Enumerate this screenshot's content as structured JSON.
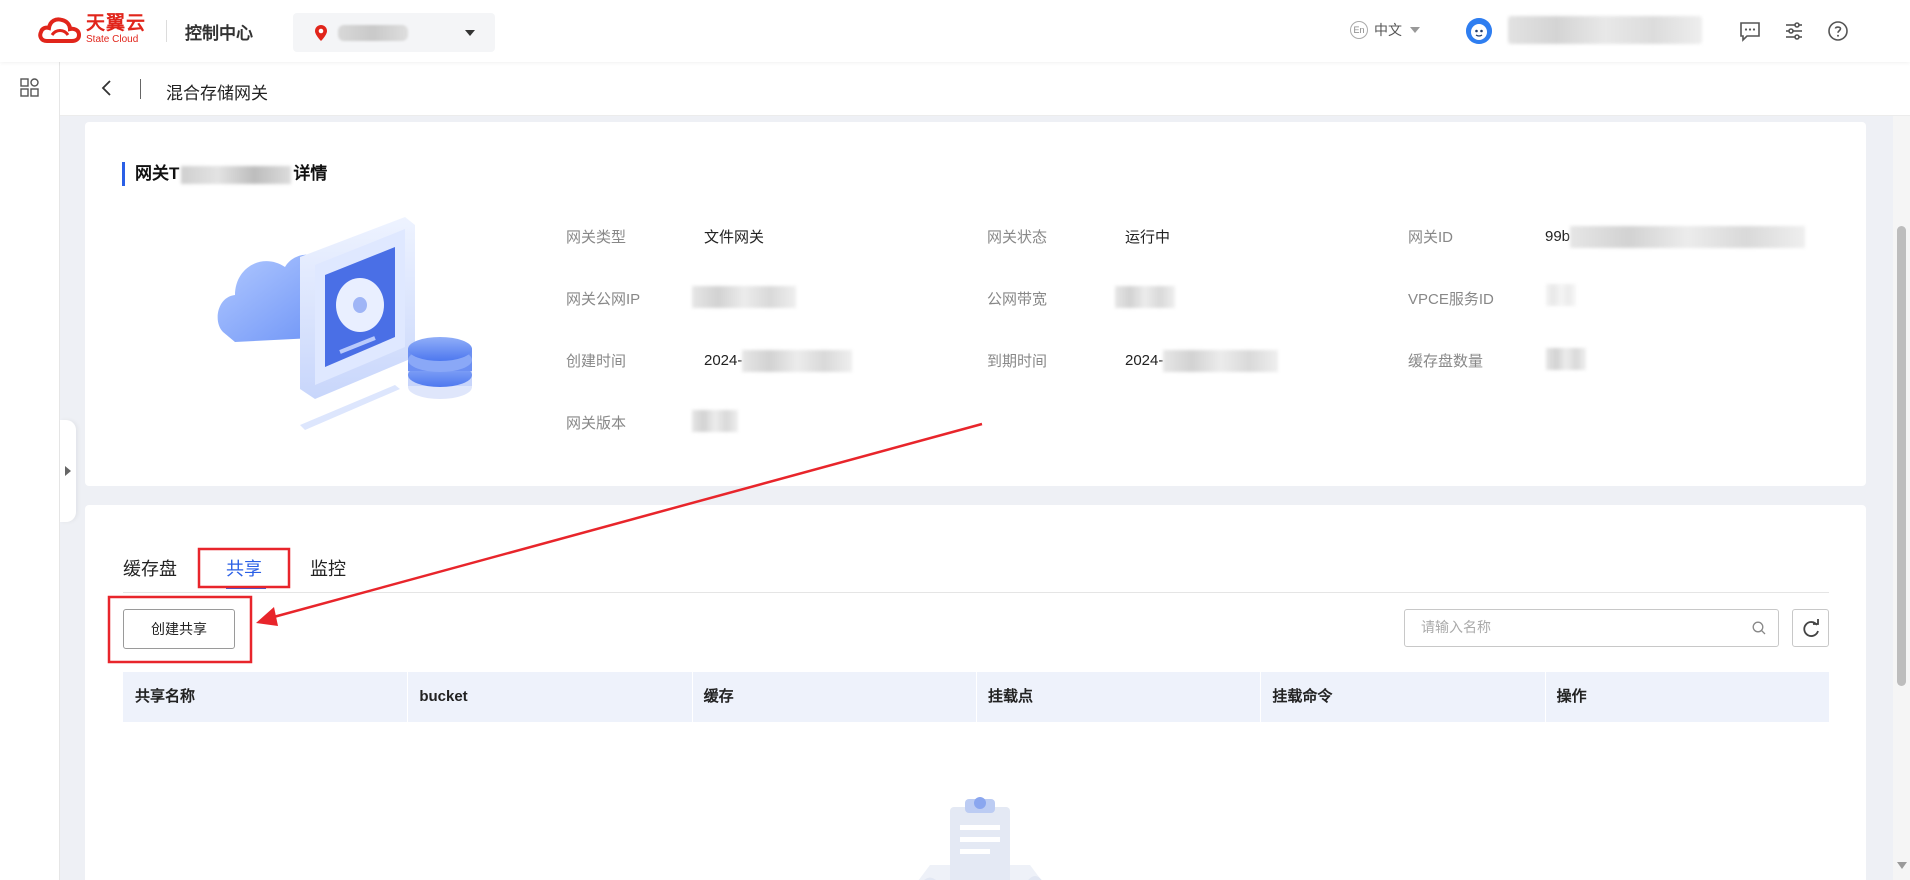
{
  "header": {
    "logo_cn": "天翼云",
    "logo_en": "State Cloud",
    "console_title": "控制中心",
    "language": "中文",
    "language_icon": "En"
  },
  "breadcrumb": {
    "title": "混合存储网关"
  },
  "detail": {
    "title_prefix": "网关T",
    "title_suffix": "详情",
    "fields": {
      "gateway_type_label": "网关类型",
      "gateway_type_value": "文件网关",
      "gateway_status_label": "网关状态",
      "gateway_status_value": "运行中",
      "gateway_id_label": "网关ID",
      "gateway_id_value": "99b",
      "public_ip_label": "网关公网IP",
      "bandwidth_label": "公网带宽",
      "vpce_label": "VPCE服务ID",
      "created_label": "创建时间",
      "created_value": "2024-",
      "expire_label": "到期时间",
      "expire_value": "2024-",
      "cache_disk_count_label": "缓存盘数量",
      "version_label": "网关版本"
    }
  },
  "tabs": [
    {
      "label": "缓存盘",
      "active": false
    },
    {
      "label": "共享",
      "active": true
    },
    {
      "label": "监控",
      "active": false
    }
  ],
  "toolbar": {
    "create_share_label": "创建共享",
    "search_placeholder": "请输入名称"
  },
  "table": {
    "columns": [
      "共享名称",
      "bucket",
      "缓存",
      "挂载点",
      "挂载命令",
      "操作"
    ]
  },
  "colors": {
    "brand_red": "#e1251b",
    "accent_blue": "#2a5fe6",
    "annotation_red": "#e8252b"
  }
}
